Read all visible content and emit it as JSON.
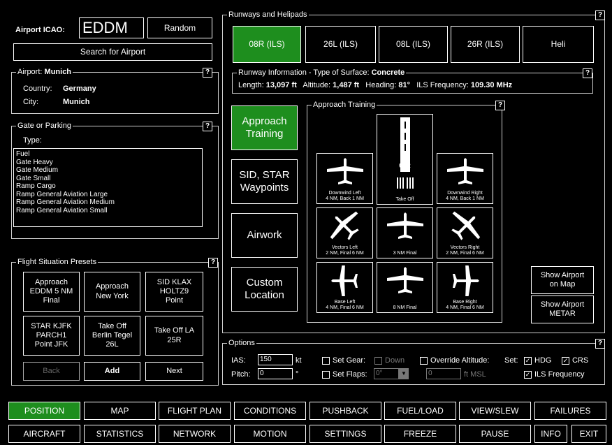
{
  "airport": {
    "icao_label": "Airport ICAO:",
    "icao_value": "EDDM",
    "random_label": "Random",
    "search_label": "Search for Airport"
  },
  "airport_info": {
    "title_prefix": "Airport:",
    "name": "Munich",
    "country_label": "Country:",
    "country": "Germany",
    "city_label": "City:",
    "city": "Munich"
  },
  "gate": {
    "title": "Gate or Parking",
    "type_label": "Type:",
    "types": [
      "Fuel",
      "Gate Heavy",
      "Gate Medium",
      "Gate Small",
      "Ramp Cargo",
      "Ramp General Aviation Large",
      "Ramp General Aviation Medium",
      "Ramp General Aviation Small"
    ]
  },
  "presets": {
    "title": "Flight Situation Presets",
    "items": [
      "Approach\nEDDM 5 NM\nFinal",
      "Approach\nNew York",
      "SID KLAX\nHOLTZ9\nPoint",
      "STAR KJFK\nPARCH1\nPoint JFK",
      "Take Off\nBerlin Tegel\n26L",
      "Take Off LA\n25R"
    ],
    "back": "Back",
    "add": "Add",
    "next": "Next"
  },
  "runways": {
    "title": "Runways and Helipads",
    "items": [
      "08R (ILS)",
      "26L (ILS)",
      "08L (ILS)",
      "26R (ILS)",
      "Heli"
    ]
  },
  "runway_info": {
    "title_prefix": "Runway Information - Type of Surface:",
    "surface": "Concrete",
    "length_label": "Length:",
    "length": "13,097 ft",
    "altitude_label": "Altitude:",
    "altitude": "1,487 ft",
    "heading_label": "Heading:",
    "heading": "81°",
    "ils_label": "ILS Frequency:",
    "ils": "109.30 MHz"
  },
  "modes": {
    "approach": "Approach\nTraining",
    "sid": "SID, STAR\nWaypoints",
    "airwork": "Airwork",
    "custom": "Custom\nLocation"
  },
  "training": {
    "title": "Approach Training",
    "runway_label": "08R",
    "tiles": [
      "Downwind Left\n4 NM, Back 1 NM",
      "Take Off",
      "Downwind Right\n4 NM, Back 1 NM",
      "Vectors Left\n2 NM, Final 6 NM",
      "3 NM Final",
      "Vectors Right\n2 NM, Final 6 NM",
      "Base Left\n4 NM, Final 6 NM",
      "8 NM Final",
      "Base Right\n4 NM, Final 6 NM"
    ]
  },
  "side": {
    "show_map": "Show Airport\non Map",
    "show_metar": "Show Airport\nMETAR"
  },
  "options": {
    "title": "Options",
    "ias_label": "IAS:",
    "ias": "150",
    "ias_unit": "kt",
    "pitch_label": "Pitch:",
    "pitch": "0",
    "pitch_unit": "°",
    "set_gear": "Set Gear:",
    "gear_down": "Down",
    "set_flaps": "Set Flaps:",
    "flaps_value": "0°",
    "override_alt": "Override Altitude:",
    "alt_value": "0",
    "alt_unit": "ft MSL",
    "set_label": "Set:",
    "hdg": "HDG",
    "crs": "CRS",
    "ils_freq": "ILS Frequency"
  },
  "nav_row1": [
    "POSITION",
    "MAP",
    "FLIGHT PLAN",
    "CONDITIONS",
    "PUSHBACK",
    "FUEL/LOAD",
    "VIEW/SLEW",
    "FAILURES"
  ],
  "nav_row2": [
    "AIRCRAFT",
    "STATISTICS",
    "NETWORK",
    "MOTION",
    "SETTINGS",
    "FREEZE",
    "PAUSE",
    "INFO",
    "EXIT"
  ],
  "help": "?",
  "check": "✓",
  "colors": {
    "accent_green": "#1e8e1e",
    "background": "#000000",
    "border": "#ffffff"
  }
}
